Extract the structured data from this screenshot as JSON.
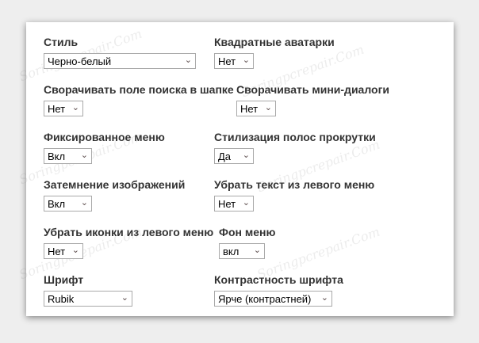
{
  "watermark": "Soringpcrepair.Com",
  "settings": [
    {
      "label": "Стиль",
      "value": "Черно-белый"
    },
    {
      "label": "Квадратные аватарки",
      "value": "Нет"
    },
    {
      "label": "Сворачивать поле поиска в шапке",
      "value": "Нет"
    },
    {
      "label": "Сворачивать мини-диалоги",
      "value": "Нет"
    },
    {
      "label": "Фиксированное меню",
      "value": "Вкл"
    },
    {
      "label": "Стилизация полос прокрутки",
      "value": "Да"
    },
    {
      "label": "Затемнение изображений",
      "value": "Вкл"
    },
    {
      "label": "Убрать текст из левого меню",
      "value": "Нет"
    },
    {
      "label": "Убрать иконки из левого меню",
      "value": "Нет"
    },
    {
      "label": "Фон меню",
      "value": "вкл"
    },
    {
      "label": "Шрифт",
      "value": "Rubik"
    },
    {
      "label": "Контрастность шрифта",
      "value": "Ярче (контрастней)"
    }
  ]
}
